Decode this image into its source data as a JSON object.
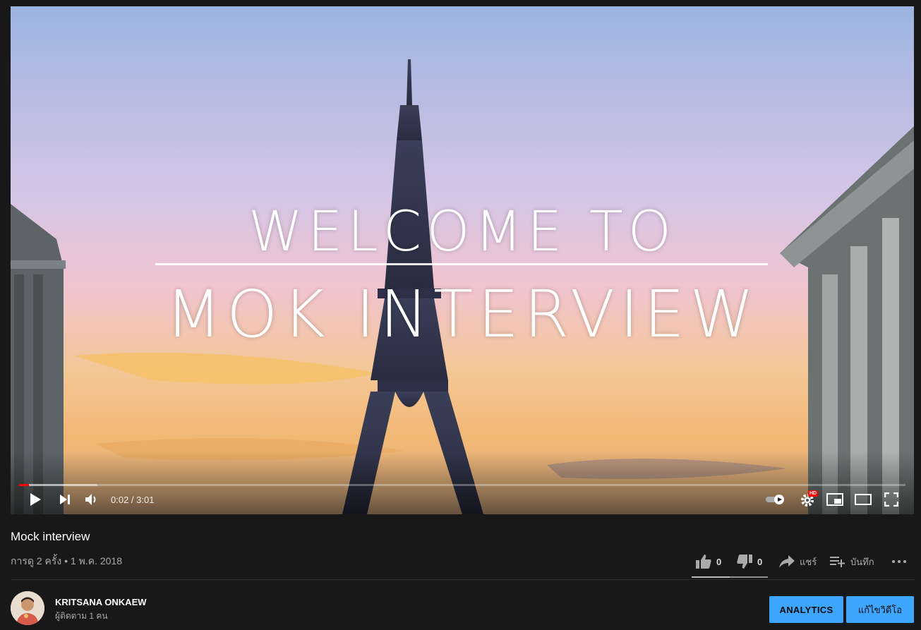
{
  "video": {
    "overlay_line1": "WELCOME TO",
    "overlay_line2": "MOK INTERVIEW",
    "progress_played_fraction": 0.011,
    "progress_loaded_fraction": 0.088
  },
  "controls": {
    "time": "0:02 / 3:01",
    "hd_badge": "HD",
    "icons": [
      "play-icon",
      "next-icon",
      "volume-icon",
      "autoplay-toggle",
      "settings-icon",
      "miniplayer-icon",
      "theater-icon",
      "fullscreen-icon"
    ]
  },
  "info": {
    "title": "Mock interview",
    "meta": "การดู 2 ครั้ง • 1 พ.ค. 2018",
    "likes": "0",
    "dislikes": "0",
    "share_label": "แชร์",
    "save_label": "บันทึก",
    "like_ratio": 0.5
  },
  "channel": {
    "name": "KRITSANA ONKAEW",
    "subscribers": "ผู้ติดตาม 1 คน"
  },
  "buttons": {
    "analytics": "ANALYTICS",
    "edit_video": "แก้ไขวิดีโอ"
  },
  "colors": {
    "background": "#181818",
    "accent_blue": "#3ea6ff",
    "progress_red": "#ff0000"
  }
}
